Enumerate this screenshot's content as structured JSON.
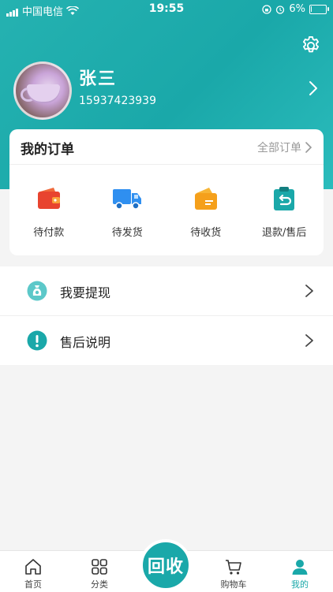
{
  "status_bar": {
    "carrier": "中国电信",
    "time": "19:55",
    "battery_percent": "6%",
    "battery_level": 0.06
  },
  "profile": {
    "name": "张三",
    "phone": "15937423939"
  },
  "orders": {
    "title": "我的订单",
    "all_label": "全部订单",
    "items": [
      {
        "label": "待付款",
        "icon": "wallet-icon",
        "color": "#e8442f"
      },
      {
        "label": "待发货",
        "icon": "truck-icon",
        "color": "#2f8ff0"
      },
      {
        "label": "待收货",
        "icon": "package-icon",
        "color": "#f5a01b"
      },
      {
        "label": "退款/售后",
        "icon": "refund-icon",
        "color": "#1aa8a9"
      }
    ]
  },
  "menu": [
    {
      "label": "我要提现",
      "icon": "money-bag-icon"
    },
    {
      "label": "售后说明",
      "icon": "exclamation-icon"
    }
  ],
  "tabbar": {
    "items": [
      {
        "label": "首页",
        "icon": "home-icon"
      },
      {
        "label": "分类",
        "icon": "grid-icon"
      },
      {
        "label": "购物车",
        "icon": "cart-icon"
      },
      {
        "label": "我的",
        "icon": "user-icon"
      }
    ],
    "center_label": "回收",
    "active": "我的"
  },
  "colors": {
    "accent": "#1aa8a9"
  }
}
